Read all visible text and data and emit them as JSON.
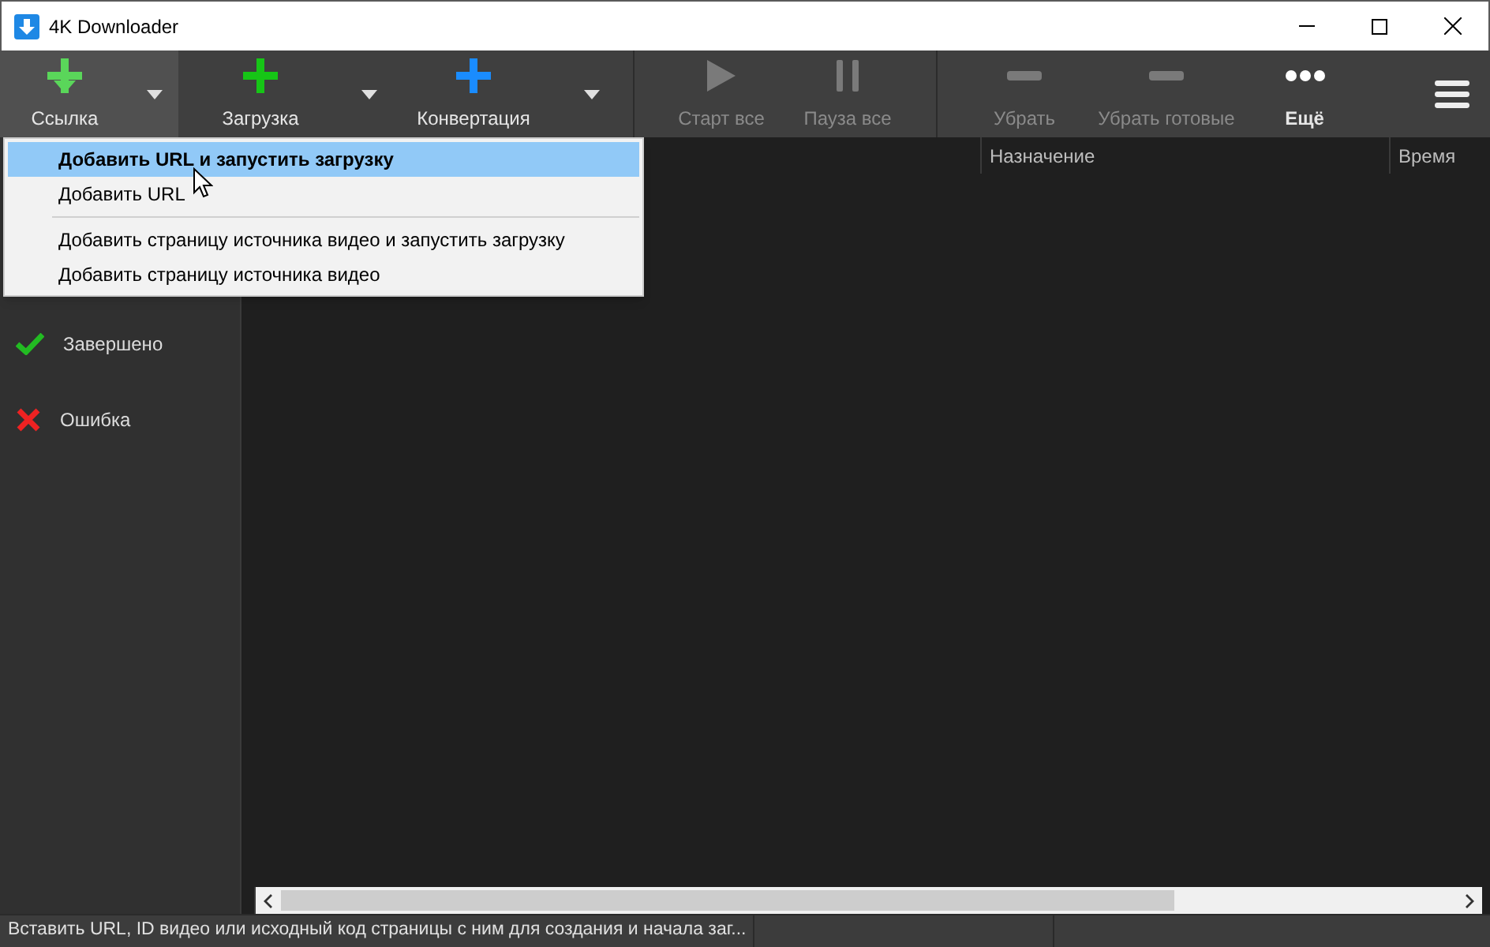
{
  "window": {
    "title": "4K Downloader"
  },
  "toolbar": {
    "groups": [
      [
        {
          "label": "Ссылка",
          "disabled": false,
          "pressed": true,
          "dropdown_open": true
        },
        {
          "label": "Загрузка",
          "disabled": false,
          "pressed": false,
          "dropdown_open": false
        },
        {
          "label": "Конвертация",
          "disabled": false,
          "pressed": false,
          "dropdown_open": false
        }
      ],
      [
        {
          "label": "Старт все",
          "disabled": true
        },
        {
          "label": "Пауза все",
          "disabled": true
        }
      ],
      [
        {
          "label": "Убрать",
          "disabled": true
        },
        {
          "label": "Убрать готовые",
          "disabled": true
        },
        {
          "label": "Ещё",
          "disabled": false
        }
      ]
    ]
  },
  "sidebar": {
    "items": [
      {
        "label": "Завершено",
        "selected": false
      },
      {
        "label": "Ошибка",
        "selected": false
      }
    ]
  },
  "table": {
    "columns": [
      "Назначение",
      "Время"
    ]
  },
  "menu": {
    "groups": [
      [
        {
          "label": "Добавить URL и запустить загрузку",
          "selected": true,
          "default": true
        },
        {
          "label": "Добавить URL",
          "selected": false,
          "default": false
        }
      ],
      [
        {
          "label": "Добавить страницу источника видео и запустить загрузку",
          "selected": false,
          "default": false
        },
        {
          "label": "Добавить страницу источника видео",
          "selected": false,
          "default": false
        }
      ]
    ]
  },
  "status_bar": {
    "text": "Вставить URL, ID видео или исходный код страницы с ним для создания и начала заг..."
  }
}
